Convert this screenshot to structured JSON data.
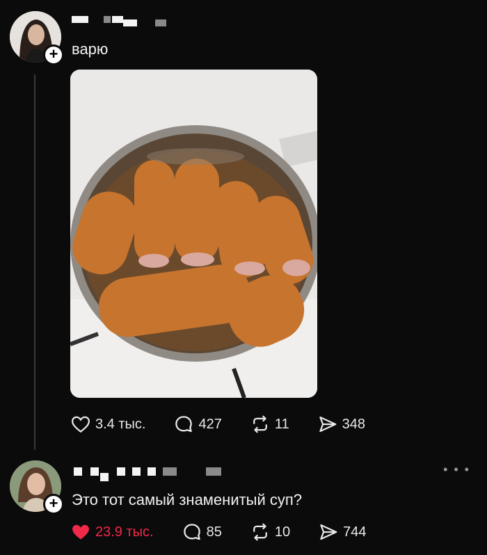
{
  "post": {
    "text": "варю",
    "actions": {
      "likes": "3.4 тыс.",
      "replies": "427",
      "reposts": "11",
      "shares": "348"
    }
  },
  "reply": {
    "text": "Это тот самый знаменитый суп?",
    "actions": {
      "likes": "23.9 тыс.",
      "replies": "85",
      "reposts": "10",
      "shares": "744"
    },
    "more_label": "• • •"
  },
  "colors": {
    "background": "#0b0b0b",
    "liked": "#f02849",
    "text": "#f2f2f2"
  },
  "icons": [
    "heart-icon",
    "comment-icon",
    "repost-icon",
    "share-icon",
    "plus-icon"
  ]
}
